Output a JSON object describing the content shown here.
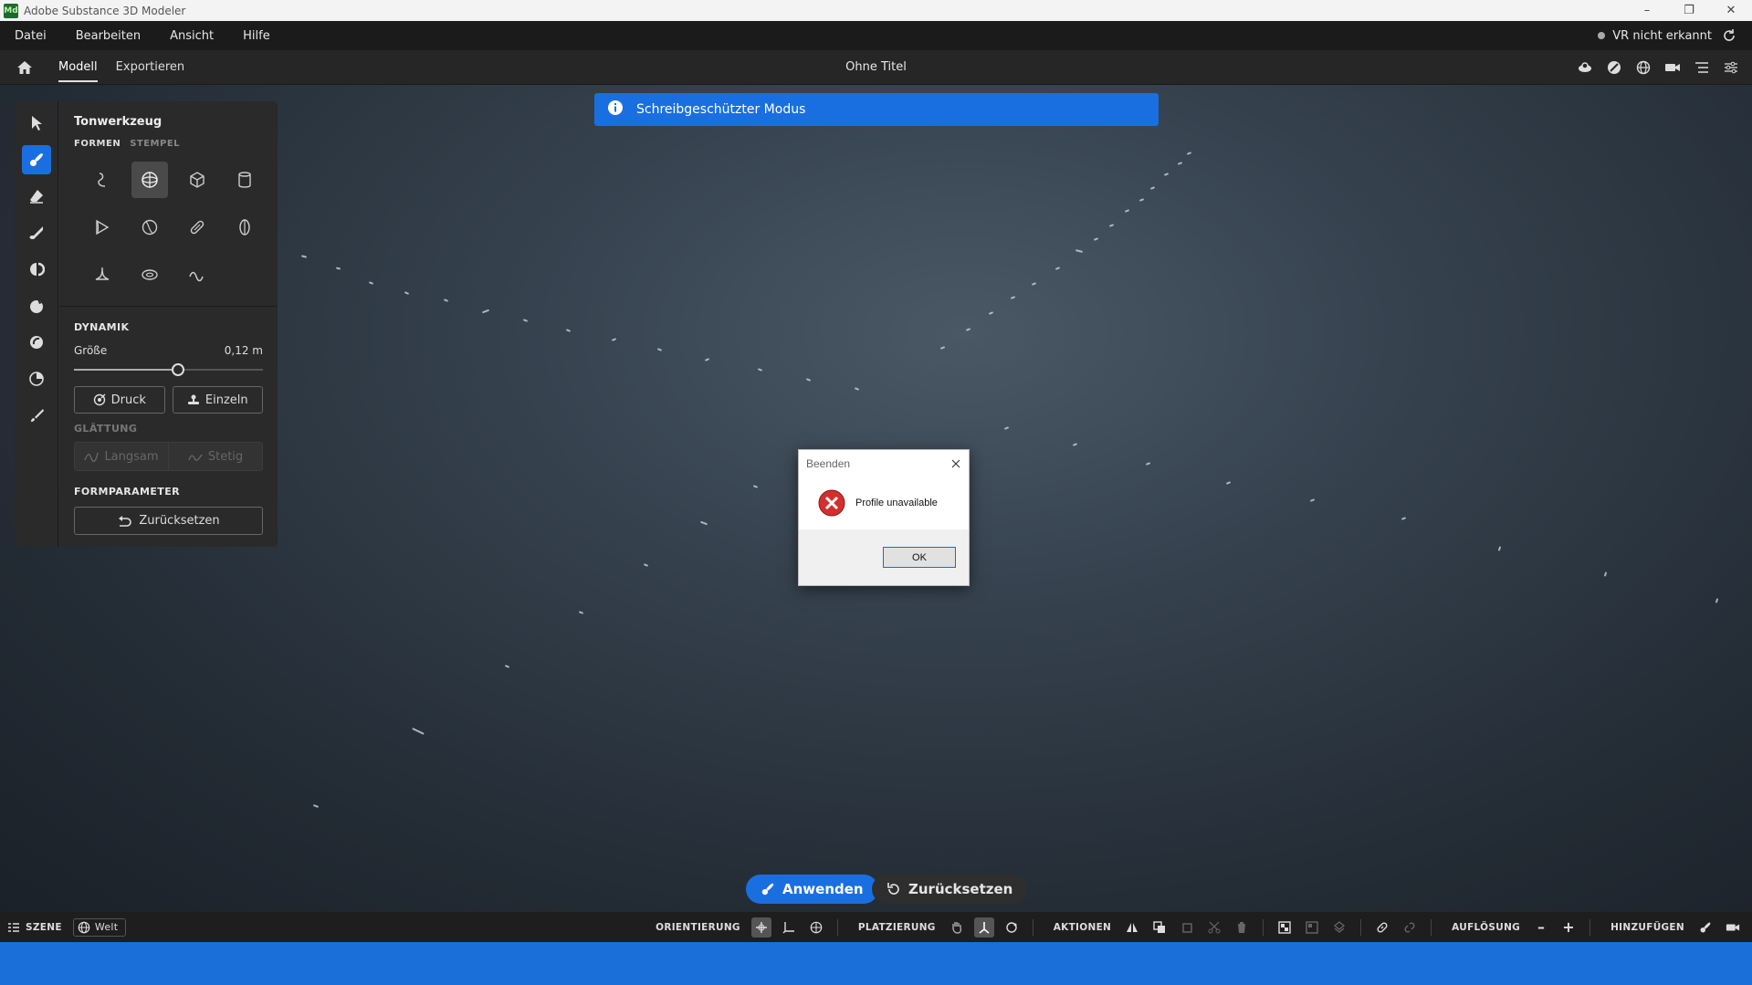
{
  "window": {
    "logo_text": "Md",
    "title": "Adobe Substance 3D Modeler",
    "minimize": "–",
    "maximize": "❐",
    "close": "✕"
  },
  "menu": {
    "items": [
      "Datei",
      "Bearbeiten",
      "Ansicht",
      "Hilfe"
    ],
    "vr_status": "VR nicht erkannt"
  },
  "tabs": {
    "items": [
      "Modell",
      "Exportieren"
    ],
    "active": "Modell",
    "document_title": "Ohne Titel"
  },
  "banner": {
    "text": "Schreibgeschützter Modus"
  },
  "panel": {
    "title": "Tonwerkzeug",
    "subtabs": [
      "FORMEN",
      "STEMPEL"
    ],
    "dynamics_title": "DYNAMIK",
    "size_label": "Größe",
    "size_value": "0,12 m",
    "size_fraction": 0.55,
    "pressure_btn": "Druck",
    "single_btn": "Einzeln",
    "smoothing_title": "GLÄTTUNG",
    "slow_btn": "Langsam",
    "steep_btn": "Stetig",
    "shape_params_title": "FORMPARAMETER",
    "reset_btn": "Zurücksetzen"
  },
  "dialog": {
    "title": "Beenden",
    "message": "Profile unavailable",
    "ok": "OK"
  },
  "actions": {
    "apply": "Anwenden",
    "reset": "Zurücksetzen"
  },
  "bottombar": {
    "scene": "SZENE",
    "world": "Welt",
    "orientation": "ORIENTIERUNG",
    "placement": "PLATZIERUNG",
    "actions": "AKTIONEN",
    "resolution": "AUFLÖSUNG",
    "add": "HINZUFÜGEN",
    "minus": "–",
    "plus": "+"
  },
  "colors": {
    "accent": "#1a6fe0",
    "statusbar": "#1b6fd8"
  }
}
